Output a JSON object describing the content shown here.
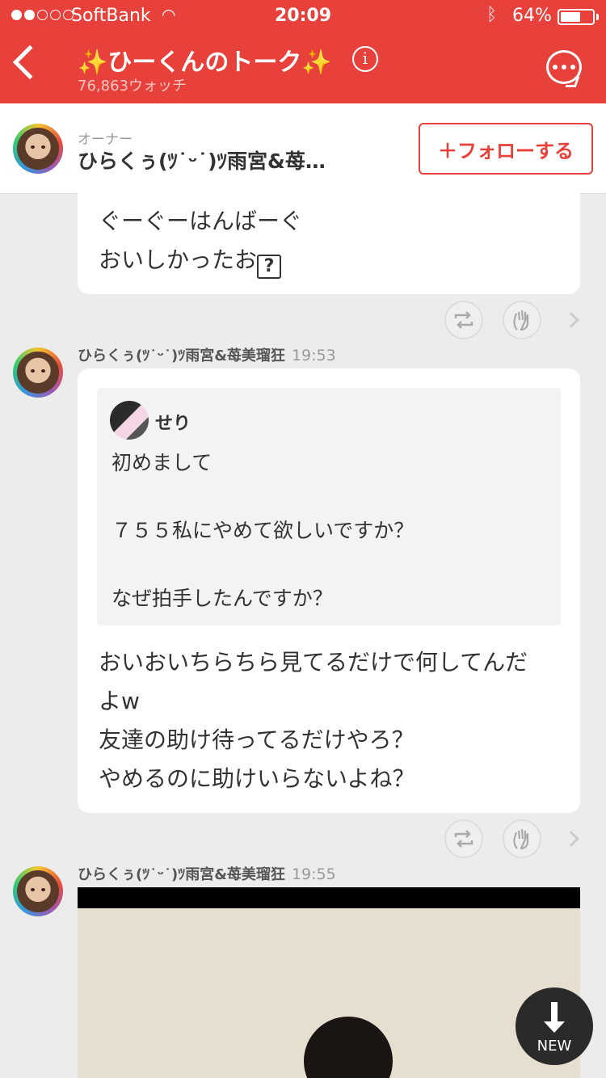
{
  "status": {
    "carrier": "SoftBank",
    "time": "20:09",
    "battery": "64%",
    "battery_level": 0.64
  },
  "header": {
    "title": "✨ひーくんのトーク✨",
    "watch_count": "76,863ウォッチ"
  },
  "owner": {
    "label": "オーナー",
    "name": "ひらくぅ(ﾂ˙ᵕ˙)ﾂ雨宮&苺…",
    "follow_label": "＋フォローする"
  },
  "messages": [
    {
      "lines": [
        "ぐーぐーはんばーぐ",
        "おいしかったお"
      ]
    },
    {
      "author": "ひらくぅ(ﾂ˙ᵕ˙)ﾂ雨宮&苺美瑠狂",
      "time": "19:53",
      "quote": {
        "author": "せり",
        "text": "初めまして\n\n７５５私にやめて欲しいですか？\n\nなぜ拍手したんですか？"
      },
      "lines": [
        "おいおいちらちら見てるだけで何してんだ",
        "よw",
        "友達の助け待ってるだけやろ？",
        "やめるのに助けいらないよね？"
      ]
    },
    {
      "author": "ひらくぅ(ﾂ˙ᵕ˙)ﾂ雨宮&苺美瑠狂",
      "time": "19:55"
    }
  ],
  "new_button": {
    "label": "NEW"
  },
  "icons": {
    "retweet": "retweet-icon",
    "clap": "clap-icon",
    "chevron": "chevron-right-icon"
  }
}
